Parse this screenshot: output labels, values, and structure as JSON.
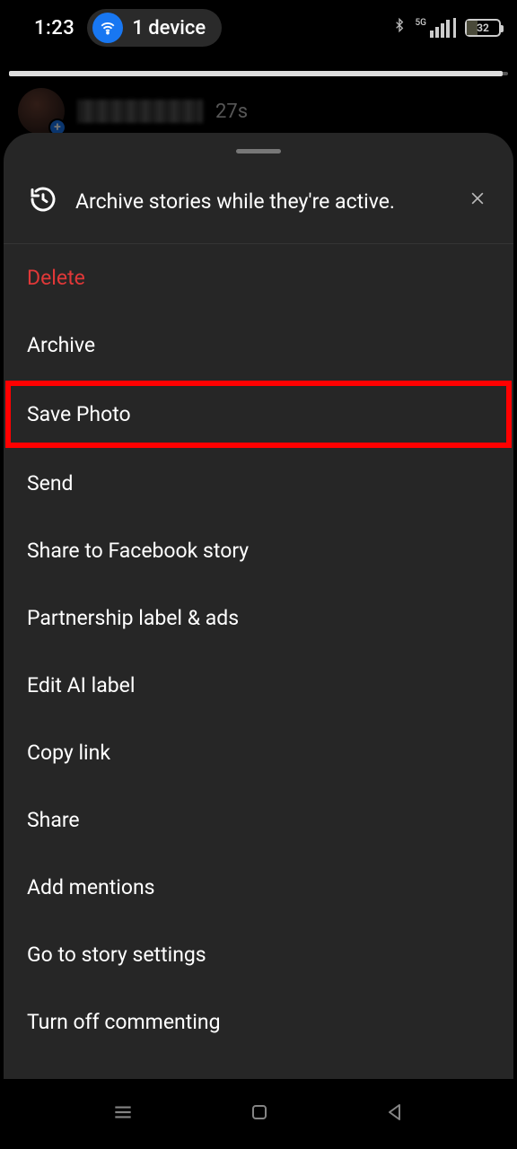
{
  "status": {
    "time": "1:23",
    "device_label": "1 device",
    "network_label": "5G",
    "battery_pct": "32"
  },
  "story": {
    "age": "27s"
  },
  "sheet": {
    "archive_hint": "Archive stories while they're active.",
    "items": {
      "delete": "Delete",
      "archive": "Archive",
      "save_photo": "Save Photo",
      "send": "Send",
      "share_fb": "Share to Facebook story",
      "partnership": "Partnership label & ads",
      "edit_ai": "Edit AI label",
      "copy_link": "Copy link",
      "share": "Share",
      "add_mentions": "Add mentions",
      "story_settings": "Go to story settings",
      "turn_off_commenting": "Turn off commenting"
    }
  }
}
